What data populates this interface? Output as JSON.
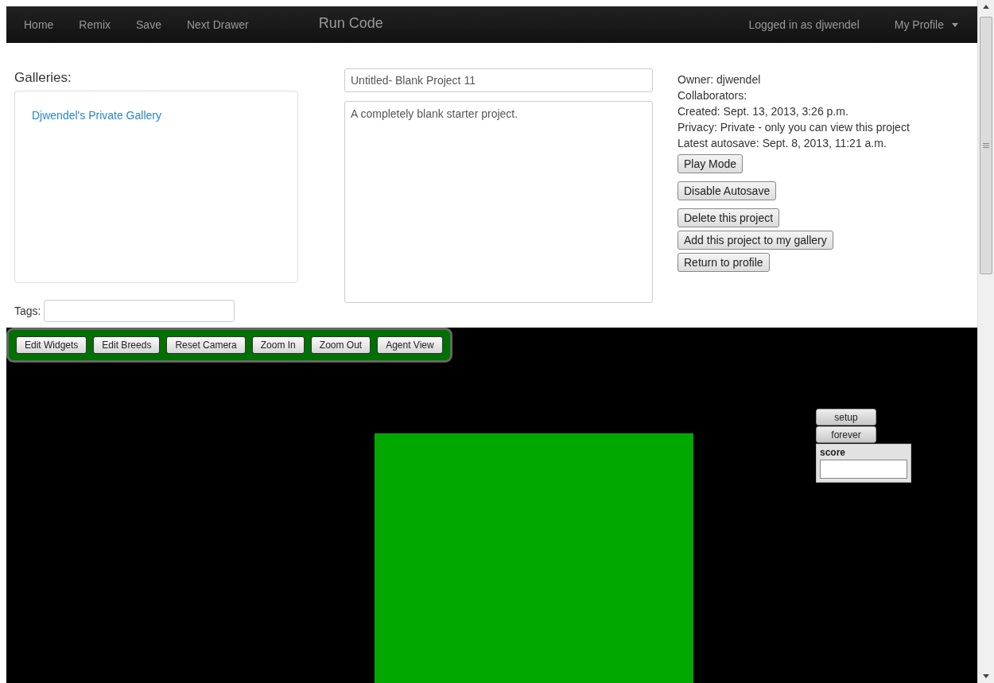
{
  "navbar": {
    "links": [
      "Home",
      "Remix",
      "Save",
      "Next Drawer"
    ],
    "brand": "Run Code",
    "user": "Logged in as djwendel",
    "profile_menu": "My Profile"
  },
  "galleries": {
    "heading": "Galleries:",
    "items": [
      "Djwendel's Private Gallery"
    ]
  },
  "tags": {
    "label": "Tags:"
  },
  "project": {
    "title": "Untitled- Blank Project 11",
    "description": "A completely blank starter project."
  },
  "info": [
    "Owner: djwendel",
    "Collaborators:",
    "Created: Sept. 13, 2013, 3:26 p.m.",
    "Privacy: Private - only you can view this project",
    "Latest autosave: Sept. 8, 2013, 11:21 a.m."
  ],
  "action_groups": [
    [
      "Play Mode"
    ],
    [
      "Disable Autosave"
    ],
    [
      "Delete this project",
      "Add this project to my gallery",
      "Return to profile"
    ]
  ],
  "toolbar": [
    "Edit Widgets",
    "Edit Breeds",
    "Reset Camera",
    "Zoom In",
    "Zoom Out",
    "Agent View"
  ],
  "widgets": [
    {
      "kind": "button",
      "label": "setup"
    },
    {
      "kind": "button",
      "label": "forever"
    },
    {
      "kind": "monitor",
      "label": "score"
    }
  ]
}
